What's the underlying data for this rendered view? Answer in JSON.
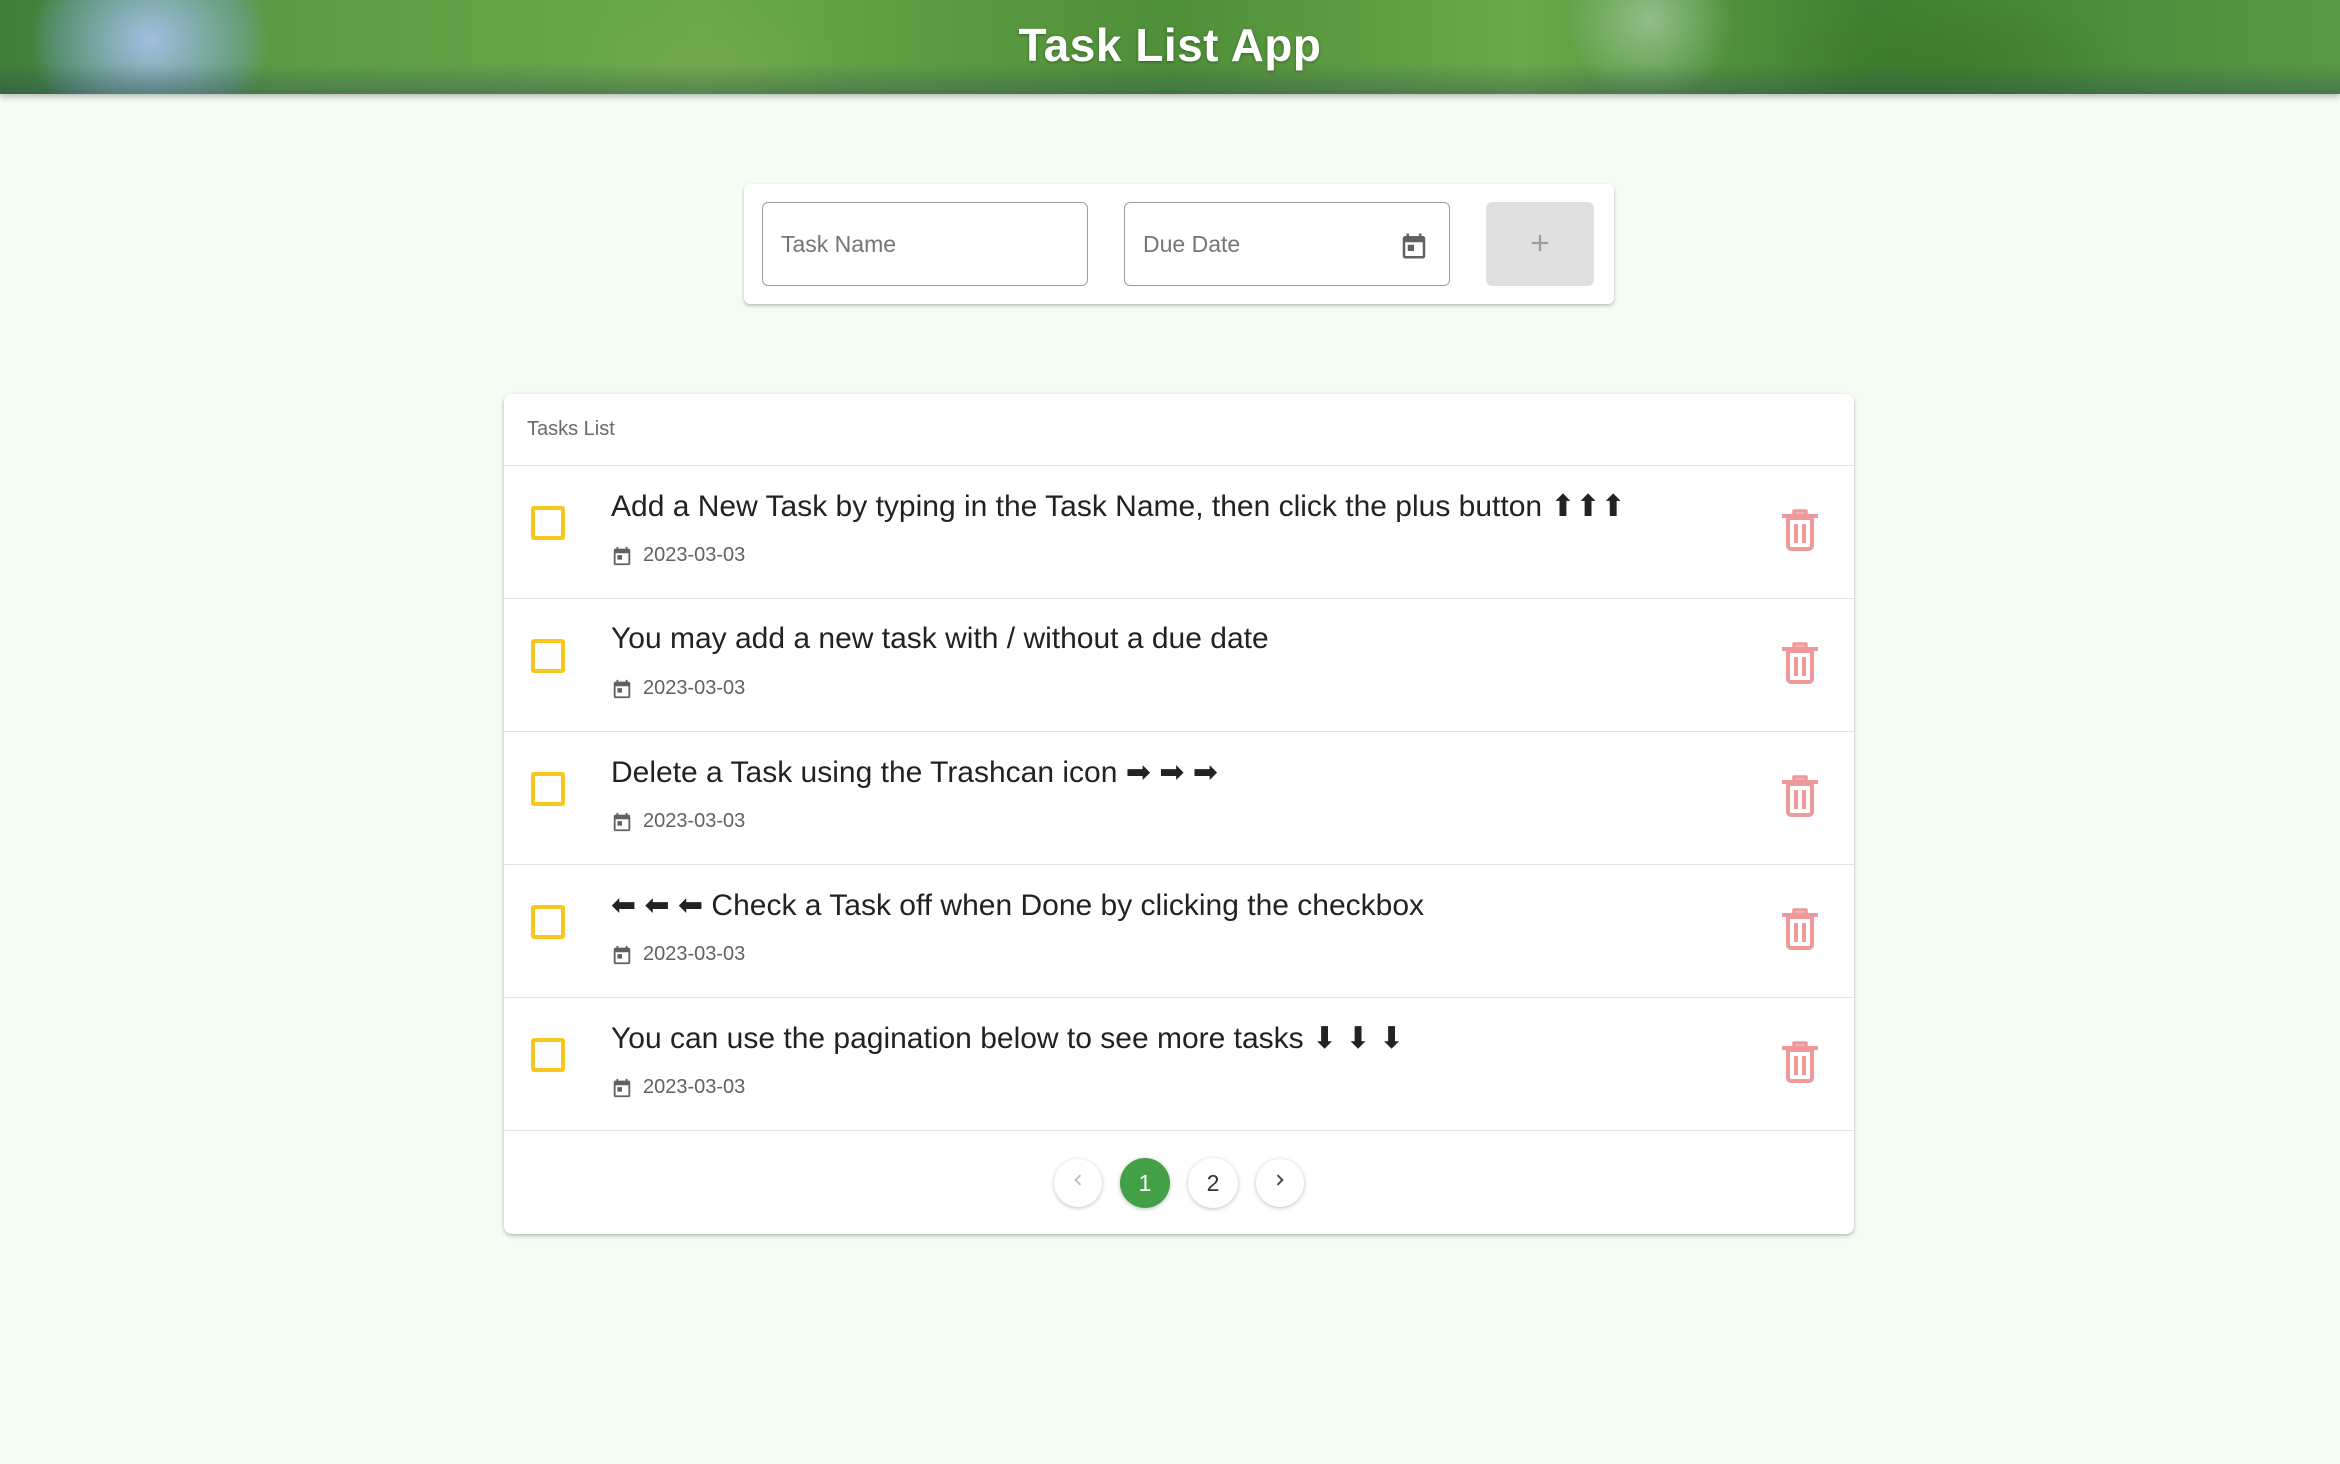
{
  "header": {
    "title": "Task List App"
  },
  "form": {
    "task_name_placeholder": "Task Name",
    "due_date_placeholder": "Due Date",
    "add_button_icon": "plus-icon"
  },
  "list": {
    "header_label": "Tasks List",
    "tasks": [
      {
        "title": "Add a New Task by typing in the Task Name, then click the plus button ⬆⬆⬆",
        "due_date": "2023-03-03",
        "done": false
      },
      {
        "title": "You may add a new task with / without a due date",
        "due_date": "2023-03-03",
        "done": false
      },
      {
        "title": "Delete a Task using the Trashcan icon ➡ ➡ ➡",
        "due_date": "2023-03-03",
        "done": false
      },
      {
        "title": "⬅ ⬅ ⬅ Check a Task off when Done by clicking the checkbox",
        "due_date": "2023-03-03",
        "done": false
      },
      {
        "title": "You can use the pagination below to see more tasks ⬇ ⬇ ⬇",
        "due_date": "2023-03-03",
        "done": false
      }
    ]
  },
  "pagination": {
    "pages": [
      "1",
      "2"
    ],
    "current_page": "1"
  },
  "colors": {
    "background": "#f3fdf3",
    "accent_green": "#43a047",
    "checkbox_yellow": "#f7c71f",
    "delete_red": "#ef9a9a"
  }
}
